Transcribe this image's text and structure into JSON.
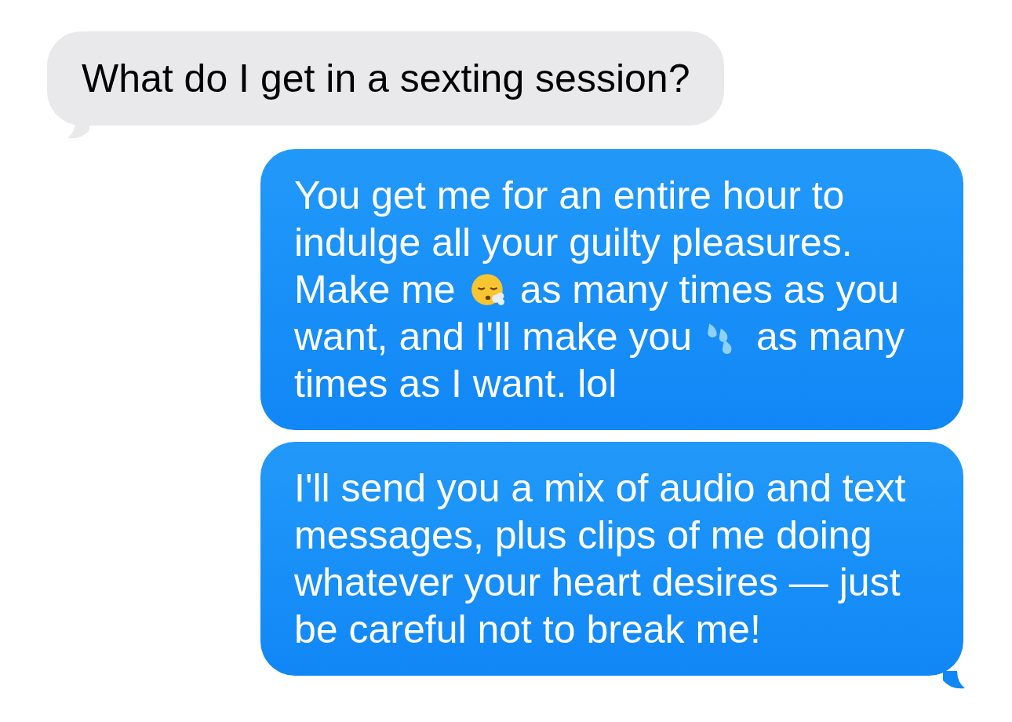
{
  "messages": [
    {
      "kind": "received",
      "tail": true,
      "lines": [
        [
          {
            "kind": "text",
            "text": "What do I get in a sexting session?"
          }
        ]
      ]
    },
    {
      "kind": "sent",
      "tail": false,
      "lines": [
        [
          {
            "kind": "text",
            "text": "You get me for an entire hour to"
          }
        ],
        [
          {
            "kind": "text",
            "text": "indulge all your guilty pleasures."
          }
        ],
        [
          {
            "kind": "text",
            "text": "Make me"
          },
          {
            "kind": "face_emoji"
          },
          {
            "kind": "text",
            "text": "as many times as you"
          }
        ],
        [
          {
            "kind": "text",
            "text": "want, and I'll make you"
          },
          {
            "kind": "droplets_emoji"
          },
          {
            "kind": "text",
            "text": "as many"
          }
        ],
        [
          {
            "kind": "text",
            "text": "times as I want. lol"
          }
        ]
      ]
    },
    {
      "kind": "sent",
      "tail": true,
      "lines": [
        [
          {
            "kind": "text",
            "text": "I'll send you a mix of audio and text"
          }
        ],
        [
          {
            "kind": "text",
            "text": "messages, plus clips of me doing"
          }
        ],
        [
          {
            "kind": "text",
            "text": "whatever your heart desires — just"
          }
        ],
        [
          {
            "kind": "text",
            "text": "be careful not to break me!"
          }
        ]
      ]
    }
  ]
}
